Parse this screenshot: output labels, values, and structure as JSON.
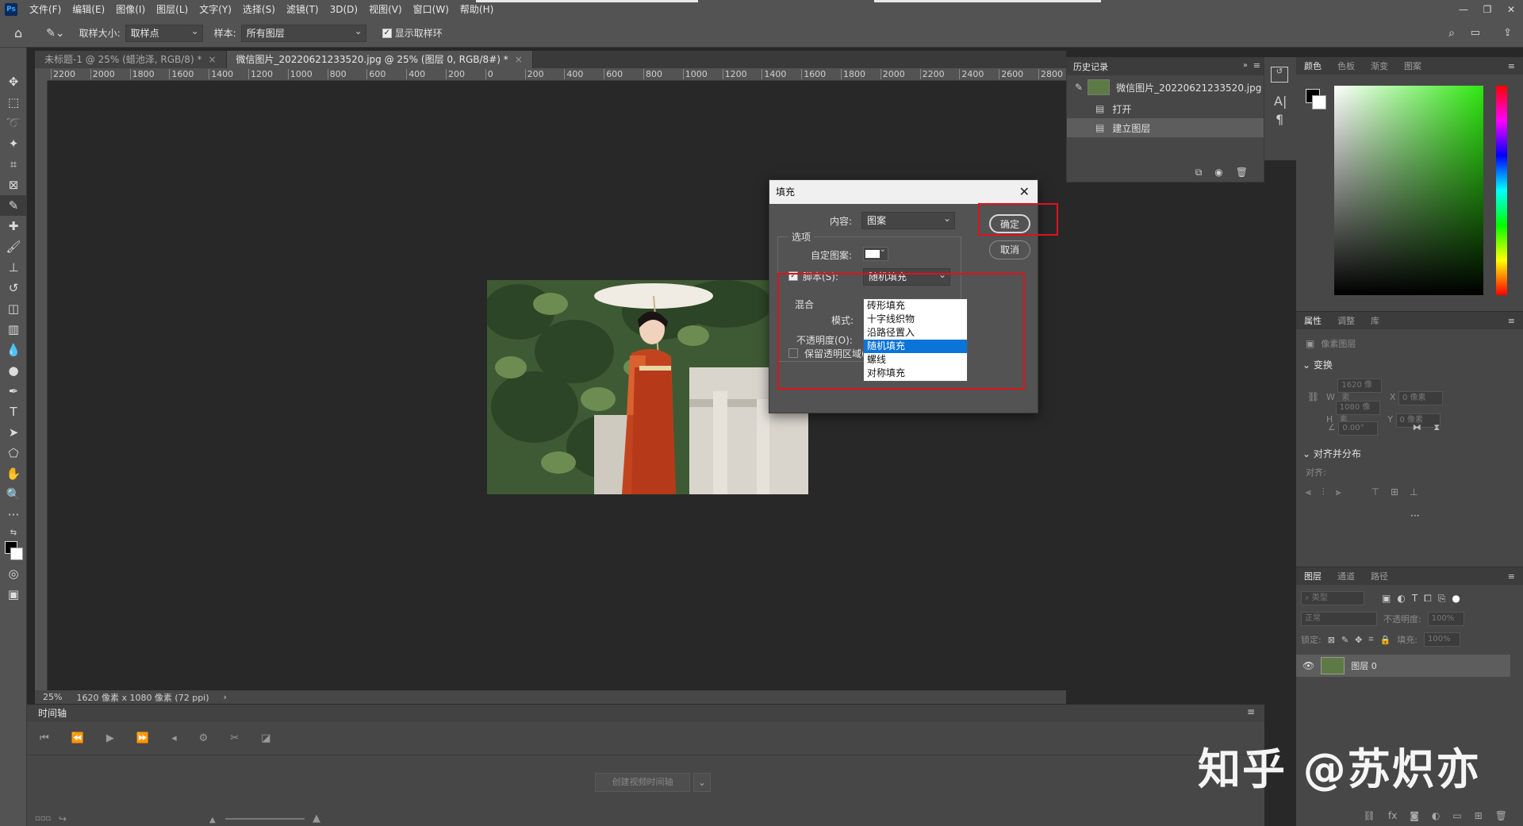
{
  "app": {
    "logo_text": "Ps",
    "menu": [
      "文件(F)",
      "编辑(E)",
      "图像(I)",
      "图层(L)",
      "文字(Y)",
      "选择(S)",
      "滤镜(T)",
      "3D(D)",
      "视图(V)",
      "窗口(W)",
      "帮助(H)"
    ]
  },
  "options_bar": {
    "sample_size_label": "取样大小:",
    "sample_size_value": "取样点",
    "sample_label": "样本:",
    "sample_value": "所有图层",
    "show_ring_label": "显示取样环"
  },
  "tabs": [
    {
      "label": "未标题-1 @ 25% (蜡池泽, RGB/8) *",
      "close": "×"
    },
    {
      "label": "微信图片_20220621233520.jpg @ 25% (图层 0, RGB/8#) *",
      "close": "×"
    }
  ],
  "ruler_ticks": [
    "2200",
    "2000",
    "1800",
    "1600",
    "1400",
    "1200",
    "1000",
    "800",
    "600",
    "400",
    "200",
    "0",
    "200",
    "400",
    "600",
    "800",
    "1000",
    "1200",
    "1400",
    "1600",
    "1800",
    "2000",
    "2200",
    "2400",
    "2600",
    "2800"
  ],
  "status": {
    "zoom": "25%",
    "doc_size": "1620 像素 x 1080 像素 (72 ppi)",
    "arrow": "›"
  },
  "timeline": {
    "title": "时间轴",
    "create_button": "创建视频时间轴"
  },
  "history": {
    "title": "历史记录",
    "items": [
      {
        "label": "微信图片_20220621233520.jpg"
      },
      {
        "label": "打开"
      },
      {
        "label": "建立图层"
      }
    ]
  },
  "color_panel": {
    "tabs": [
      "颜色",
      "色板",
      "渐变",
      "图案"
    ]
  },
  "properties_panel": {
    "tabs": [
      "属性",
      "调整",
      "库"
    ],
    "pixel_layer": "像素图层",
    "transform_title": "变换",
    "w_label": "W",
    "w_value": "1620 像素",
    "h_label": "H",
    "h_value": "1080 像素",
    "x_label": "X",
    "x_value": "0 像素",
    "y_label": "Y",
    "y_value": "0 像素",
    "angle_value": "0.00°",
    "align_title": "对齐并分布",
    "align_label": "对齐:",
    "more": "···"
  },
  "layers_panel": {
    "tabs": [
      "图层",
      "通道",
      "路径"
    ],
    "search_placeholder": "类型",
    "blend_mode": "正常",
    "opacity_label": "不透明度:",
    "opacity_value": "100%",
    "lock_label": "锁定:",
    "fill_label": "填充:",
    "fill_value": "100%",
    "layer_name": "图层 0"
  },
  "fill_dialog": {
    "title": "填充",
    "content_label": "内容:",
    "content_value": "图案",
    "options_label": "选项",
    "custom_pattern_label": "自定图案:",
    "script_label": "脚本(S):",
    "script_value": "随机填充",
    "blend_label": "混合",
    "mode_label": "模式:",
    "opacity_label": "不透明度(O):",
    "preserve_label": "保留透明区域(P)",
    "ok_button": "确定",
    "cancel_button": "取消",
    "script_options": [
      "砖形填充",
      "十字线织物",
      "沿路径置入",
      "随机填充",
      "螺线",
      "对称填充"
    ],
    "selected_index": 3
  },
  "watermark": "知乎 @苏炽亦"
}
